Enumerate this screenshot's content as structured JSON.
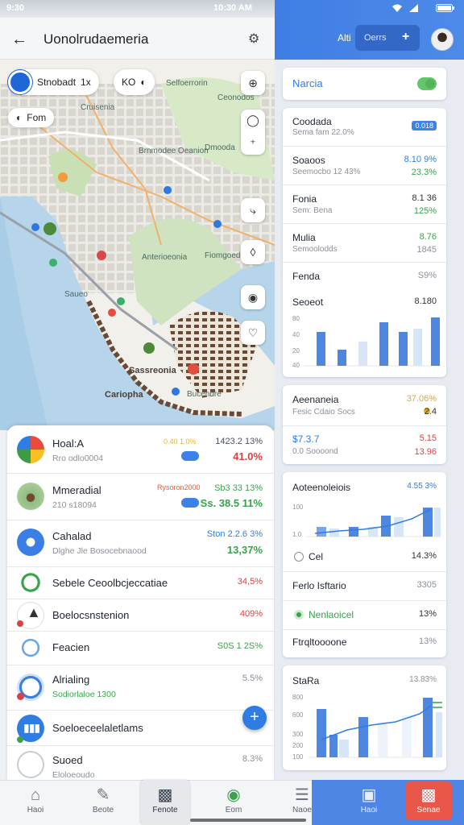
{
  "status_bar": {
    "time_left": "9:30",
    "time_mid": "10:30 AM"
  },
  "left_header": {
    "title": "Uonolrudaemeria"
  },
  "map": {
    "chip_primary": {
      "label": "Stnobadt",
      "badge": "1x"
    },
    "chip_secondary": {
      "label": "KO"
    },
    "chip_tertiary": {
      "label": "Fom"
    },
    "labels": [
      "Ceonodos",
      "Brnmodee Oeanion",
      "Dmooda",
      "Anterioeonia",
      "Fiomgoedadd",
      "Saueo",
      "Sassreonia",
      "Cariopha",
      "Bucendre",
      "Selfoerrorin",
      "Cruisenia"
    ]
  },
  "list": {
    "rows": [
      {
        "name": "Hoal:A",
        "sub": "Rro odlo0004",
        "val_top": "1423.2 13%",
        "val_bottom": "41.0%",
        "mid_label": "0.40 1.0%"
      },
      {
        "name": "Mmeradial",
        "sub": "210 s18094",
        "val_top": "Sb3 33 13%",
        "val_bottom": "Ss. 38.5 11%",
        "mid_label": "Rysoron2000"
      },
      {
        "name": "Cahalad",
        "sub": "Dlghe Jle Bosocebnaood",
        "val_top": "Ston 2.2.6 3%",
        "val_bottom": "13,37%"
      },
      {
        "name": "Sebele Ceoolbcjeccatiae",
        "val_top": "34,5%"
      },
      {
        "name": "Boelocsnstenion",
        "val_top": "409%"
      },
      {
        "name": "Feacien",
        "val_top": "S0S 1 2S%"
      },
      {
        "name": "Alrialing",
        "sub": "Sodiorlaloe 1300",
        "val_top": "5.5%"
      },
      {
        "name": "Soeloeceelaletlams"
      },
      {
        "name": "Suoed",
        "sub": "Eloloeoudo",
        "val_top": "8.3%"
      }
    ],
    "fab_label": "+"
  },
  "right_header": {
    "label": "Alti",
    "button_label": "Oerrs",
    "button_icon": "+"
  },
  "right": {
    "card1": {
      "title": "Narcia"
    },
    "card2": {
      "rows": [
        {
          "title": "Coodada",
          "sub": "Sema fam 22.0%",
          "r1": "0.018",
          "r2": ""
        },
        {
          "title": "Soaoos",
          "sub": "Seemocbo 12 43%",
          "r1": "8.10 9%",
          "r2": "23.3%"
        },
        {
          "title": "Fonia",
          "sub": "Sem: Bena",
          "r1": "8.1 36",
          "r2": "125%"
        },
        {
          "title": "Mulia",
          "sub": "Semoolodds",
          "r1": "8.76",
          "r2": "1845"
        },
        {
          "title": "Fenda",
          "sub": "",
          "r1": "S9%",
          "r2": ""
        },
        {
          "title": "Seoeot",
          "sub": "",
          "r1": "8.180",
          "r2": ""
        }
      ],
      "axis": [
        "80",
        "40",
        "20",
        "40"
      ]
    },
    "card3": {
      "title": "Aeenaneia",
      "title_val": "37.06%",
      "sub": "Fesic Cdaio Socs",
      "sub_val": "2.4",
      "row2_title": "$7.3.7",
      "row2_val": "5.15",
      "row2_sub": "0.0 Soooond",
      "row2_sub_val": "13.96"
    },
    "card4": {
      "title": "Aoteenoleiois",
      "title_val": "4.55 3%",
      "axis": [
        "100",
        "1.0"
      ],
      "rows": [
        {
          "title": "Cel",
          "val": "14.3%"
        },
        {
          "title": "Ferlo Isftario",
          "val": "3305"
        },
        {
          "title": "Nenlaoicel",
          "val": "13%"
        },
        {
          "title": "Ftrqltoooone",
          "val": "13%"
        }
      ]
    },
    "card5": {
      "title": "StaRa",
      "title_val": "13.83%",
      "axis": [
        "800",
        "600",
        "300",
        "200",
        "100"
      ]
    }
  },
  "bottom_nav": {
    "items": [
      {
        "label": "Haoi"
      },
      {
        "label": "Beote"
      },
      {
        "label": "Fenote"
      },
      {
        "label": "Eom"
      },
      {
        "label": "Naoe"
      },
      {
        "label": "Haoi"
      },
      {
        "label": "Senae"
      }
    ]
  }
}
